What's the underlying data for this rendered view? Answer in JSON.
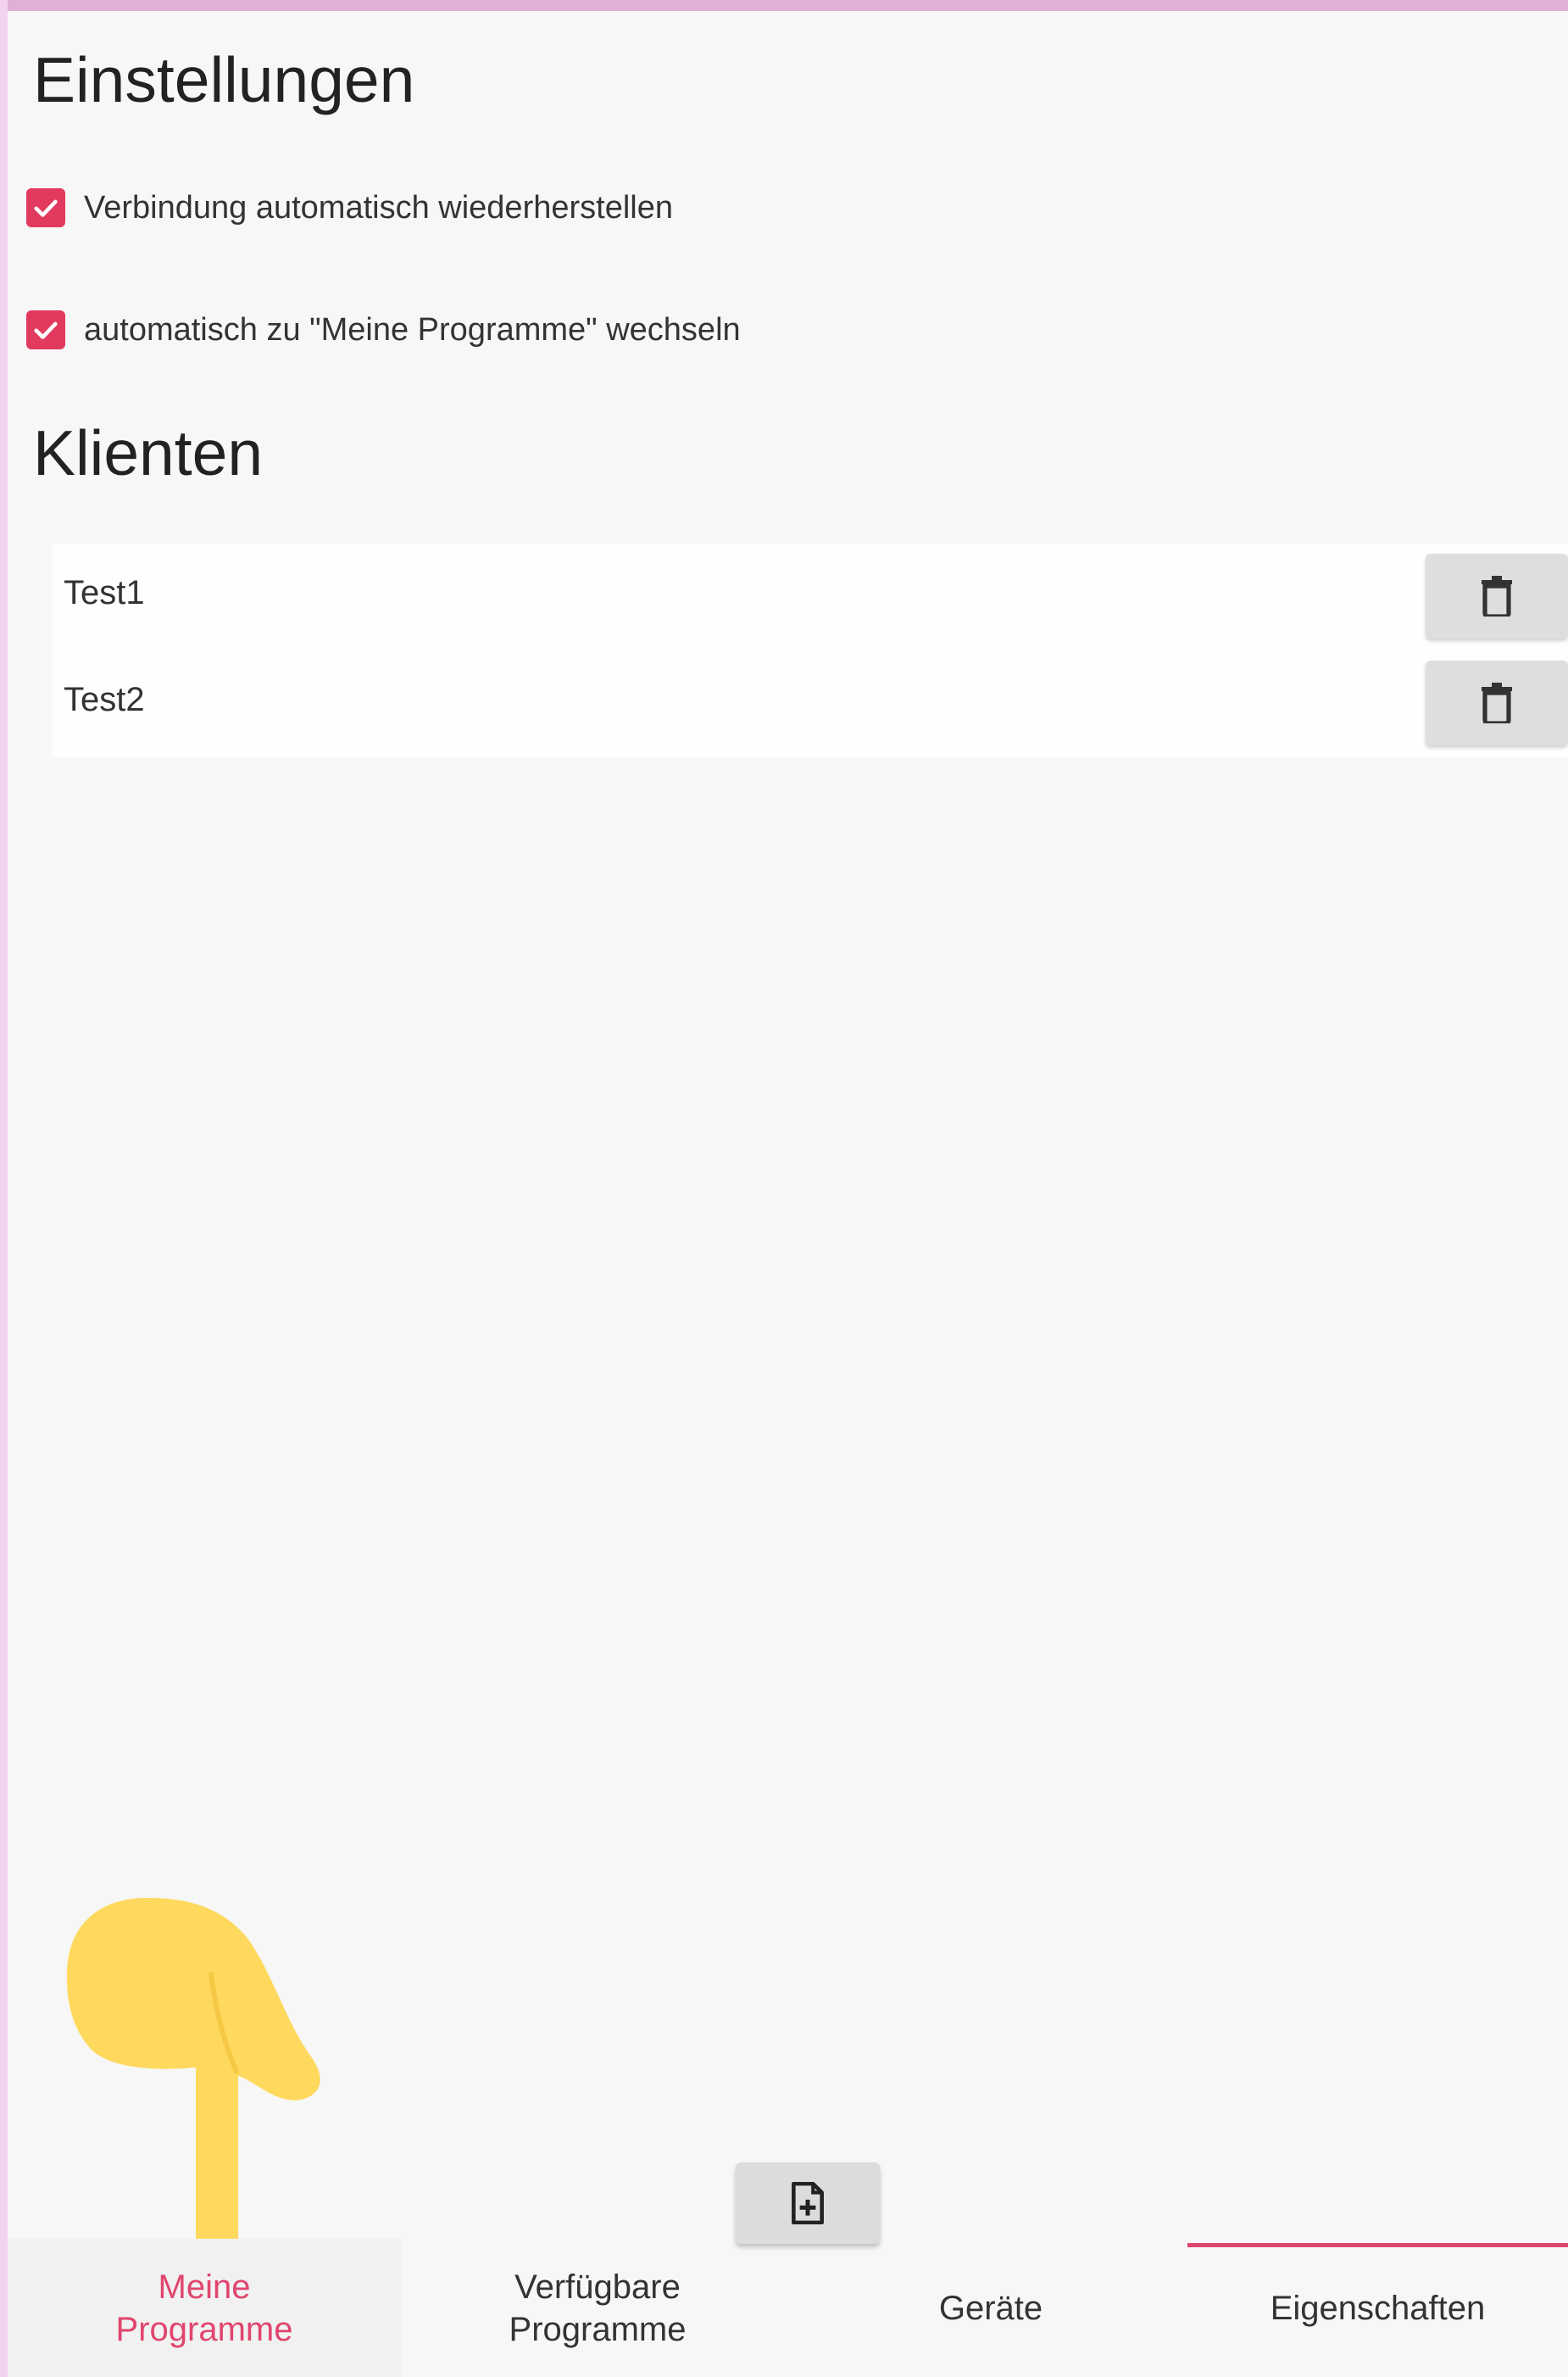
{
  "settings": {
    "title": "Einstellungen",
    "options": [
      {
        "label": "Verbindung automatisch wiederherstellen",
        "checked": true
      },
      {
        "label": "automatisch zu \"Meine Programme\" wechseln",
        "checked": true
      }
    ]
  },
  "clients": {
    "title": "Klienten",
    "items": [
      {
        "name": "Test1",
        "action_icon": "trash-icon"
      },
      {
        "name": "Test2",
        "action_icon": "trash-icon"
      }
    ]
  },
  "toolbar": {
    "add_icon": "file-plus-icon"
  },
  "tabs": [
    {
      "line1": "Meine",
      "line2": "Programme",
      "active_color": "#e0456d"
    },
    {
      "line1": "Verfügbare",
      "line2": "Programme"
    },
    {
      "line1": "Geräte",
      "line2": ""
    },
    {
      "line1": "Eigenschaften",
      "line2": "",
      "selected": true
    }
  ],
  "colors": {
    "accent": "#e0456d",
    "checkbox": "#e23a5e",
    "hand": "#ffd95e"
  }
}
